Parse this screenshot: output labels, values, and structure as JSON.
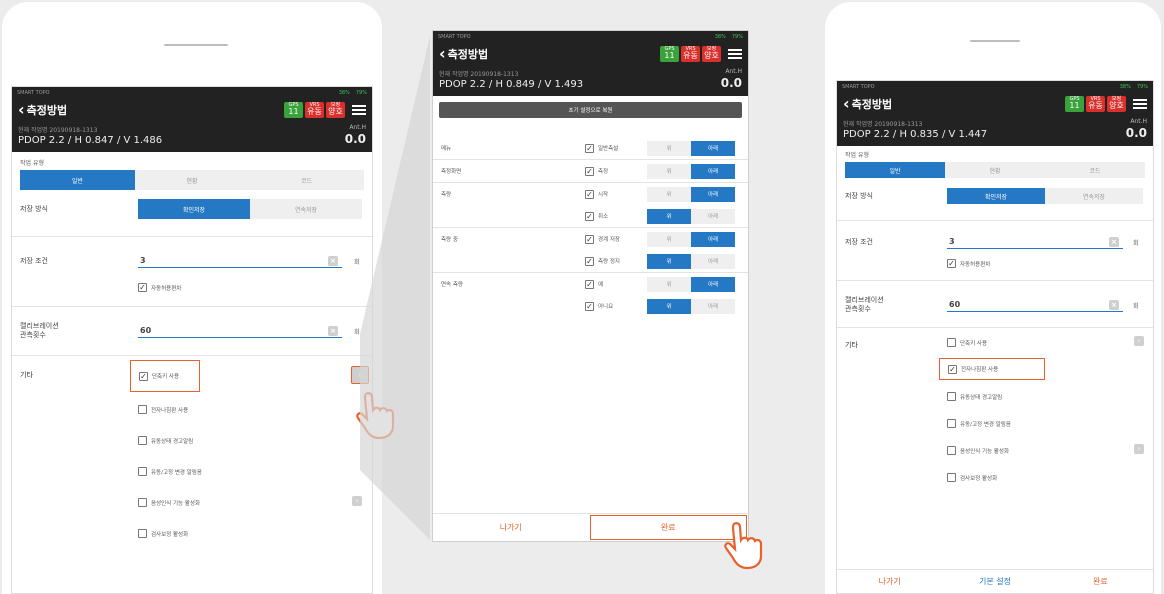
{
  "common": {
    "status_brand": "SMART TOPO",
    "status_signal": "38%",
    "status_battery": "79%",
    "app_title": "측정방법",
    "badge_gps_top": "GPS",
    "badge_gps_num": "11",
    "badge_vrs_top": "VRS",
    "badge_vrs_bot": "유동",
    "badge_bojung_top": "보정",
    "badge_bojung_bot": "양호",
    "job_label": "현재 작업명 20190918-1313",
    "anth_label": "Ant.H",
    "anth_value": "0.0",
    "colors": {
      "accent": "#2478c4",
      "highlight": "#e8602b",
      "topbar": "#222222",
      "gps": "#3aa23a",
      "vrs": "#d9302c"
    }
  },
  "left": {
    "dop": "PDOP 2.2 / H 0.847 / V 1.486",
    "work_type_label": "작업 유형",
    "work_type_options": [
      "일반",
      "현황",
      "코드"
    ],
    "save_method_label": "저장 방식",
    "save_method_options": [
      "확인저장",
      "연속저장"
    ],
    "save_cond_label": "저장 조건",
    "save_cond_value": "3",
    "save_cond_unit": "회",
    "auto_avg_label": "자동허용편차",
    "calib_label_1": "캘리브레이션",
    "calib_label_2": "관측횟수",
    "calib_value": "60",
    "calib_unit": "회",
    "etc_label": "기타",
    "etc_items": [
      "단축키 사용",
      "전자나침판 사용",
      "유동상태 경고알림",
      "유동/고정 변경 알림음",
      "음성인식 기능 활성화",
      "검사보정 활성화"
    ]
  },
  "middle": {
    "dop": "PDOP 2.2 / H 0.849 / V 1.493",
    "reset_button": "초기 설정으로 복원",
    "rows": [
      {
        "label": "메뉴",
        "check": "일반측설",
        "opt": [
          "위",
          "아래"
        ]
      },
      {
        "label": "측정화면",
        "check": "측정",
        "opt": [
          "위",
          "아래"
        ]
      },
      {
        "label": "측량",
        "check": "시작",
        "opt": [
          "위",
          "아래"
        ]
      },
      {
        "label": "",
        "check": "취소",
        "opt": [
          "위",
          "아래"
        ]
      },
      {
        "label": "측량 중",
        "check": "경계 저장",
        "opt": [
          "위",
          "아래"
        ]
      },
      {
        "label": "",
        "check": "측량 정지",
        "opt": [
          "위",
          "아래"
        ]
      },
      {
        "label": "연속 측량",
        "check": "예",
        "opt": [
          "위",
          "아래"
        ]
      },
      {
        "label": "",
        "check": "아니요",
        "opt": [
          "위",
          "아래"
        ]
      }
    ],
    "exit_button": "나가기",
    "done_button": "완료"
  },
  "right": {
    "dop": "PDOP 2.2 / H 0.835 / V 1.447",
    "work_type_label": "작업 유형",
    "work_type_options": [
      "일반",
      "현황",
      "코드"
    ],
    "save_method_label": "저장 방식",
    "save_method_options": [
      "확인저장",
      "연속저장"
    ],
    "save_cond_label": "저장 조건",
    "save_cond_value": "3",
    "save_cond_unit": "회",
    "auto_avg_label": "자동허용편차",
    "calib_label_1": "캘리브레이션",
    "calib_label_2": "관측횟수",
    "calib_value": "60",
    "calib_unit": "회",
    "etc_label": "기타",
    "etc_items": [
      "단축키 사용",
      "전자나침판 사용",
      "유동상태 경고알림",
      "유동/고정 변경 알림음",
      "음성인식 기능 활성화",
      "검사보정 활성화"
    ],
    "exit_button": "나가기",
    "default_button": "기본 설정",
    "done_button": "완료"
  }
}
